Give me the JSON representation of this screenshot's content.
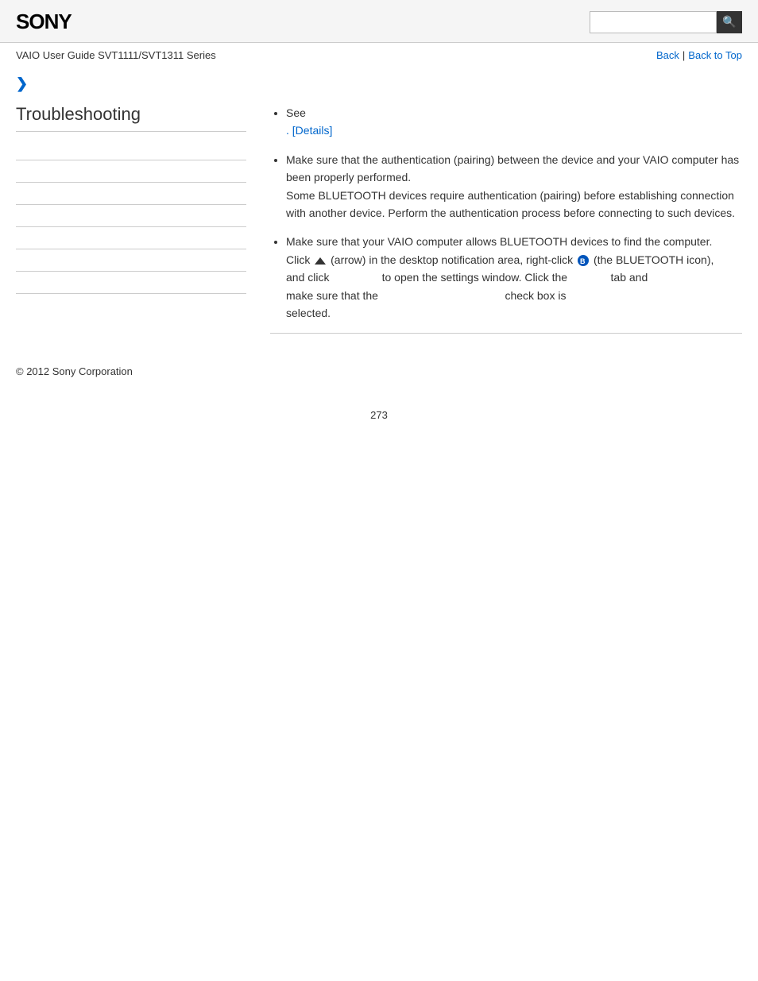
{
  "header": {
    "logo": "SONY",
    "search_placeholder": "",
    "search_icon": "🔍"
  },
  "breadcrumb": {
    "guide_title": "VAIO User Guide SVT1111/SVT1311 Series",
    "back_label": "Back",
    "back_to_top_label": "Back to Top",
    "separator": "|"
  },
  "sidebar": {
    "title": "Troubleshooting",
    "items": [
      {
        "label": ""
      },
      {
        "label": ""
      },
      {
        "label": ""
      },
      {
        "label": ""
      },
      {
        "label": ""
      },
      {
        "label": ""
      },
      {
        "label": ""
      }
    ]
  },
  "content": {
    "bullet1": {
      "text_before": "See",
      "details_link": ". [Details]"
    },
    "bullet2": {
      "text1": "Make sure that the authentication (pairing) between the device and your VAIO computer has been properly performed.",
      "text2": "Some BLUETOOTH devices require authentication (pairing) before establishing connection with another device. Perform the authentication process before connecting to such devices."
    },
    "bullet3": {
      "line1": "Make sure that your VAIO computer allows BLUETOOTH devices to find the computer.",
      "line2_part1": "Click",
      "line2_part2": "(arrow) in the desktop notification area, right-click",
      "line2_part3": "(the BLUETOOTH icon),",
      "line3_part1": "and click",
      "line3_part2": "to open the settings window. Click the",
      "line3_part3": "tab and",
      "line4_part1": "make sure that the",
      "line4_part2": "check box is",
      "line5": "selected."
    }
  },
  "footer": {
    "copyright": "© 2012 Sony Corporation"
  },
  "page_number": "273"
}
